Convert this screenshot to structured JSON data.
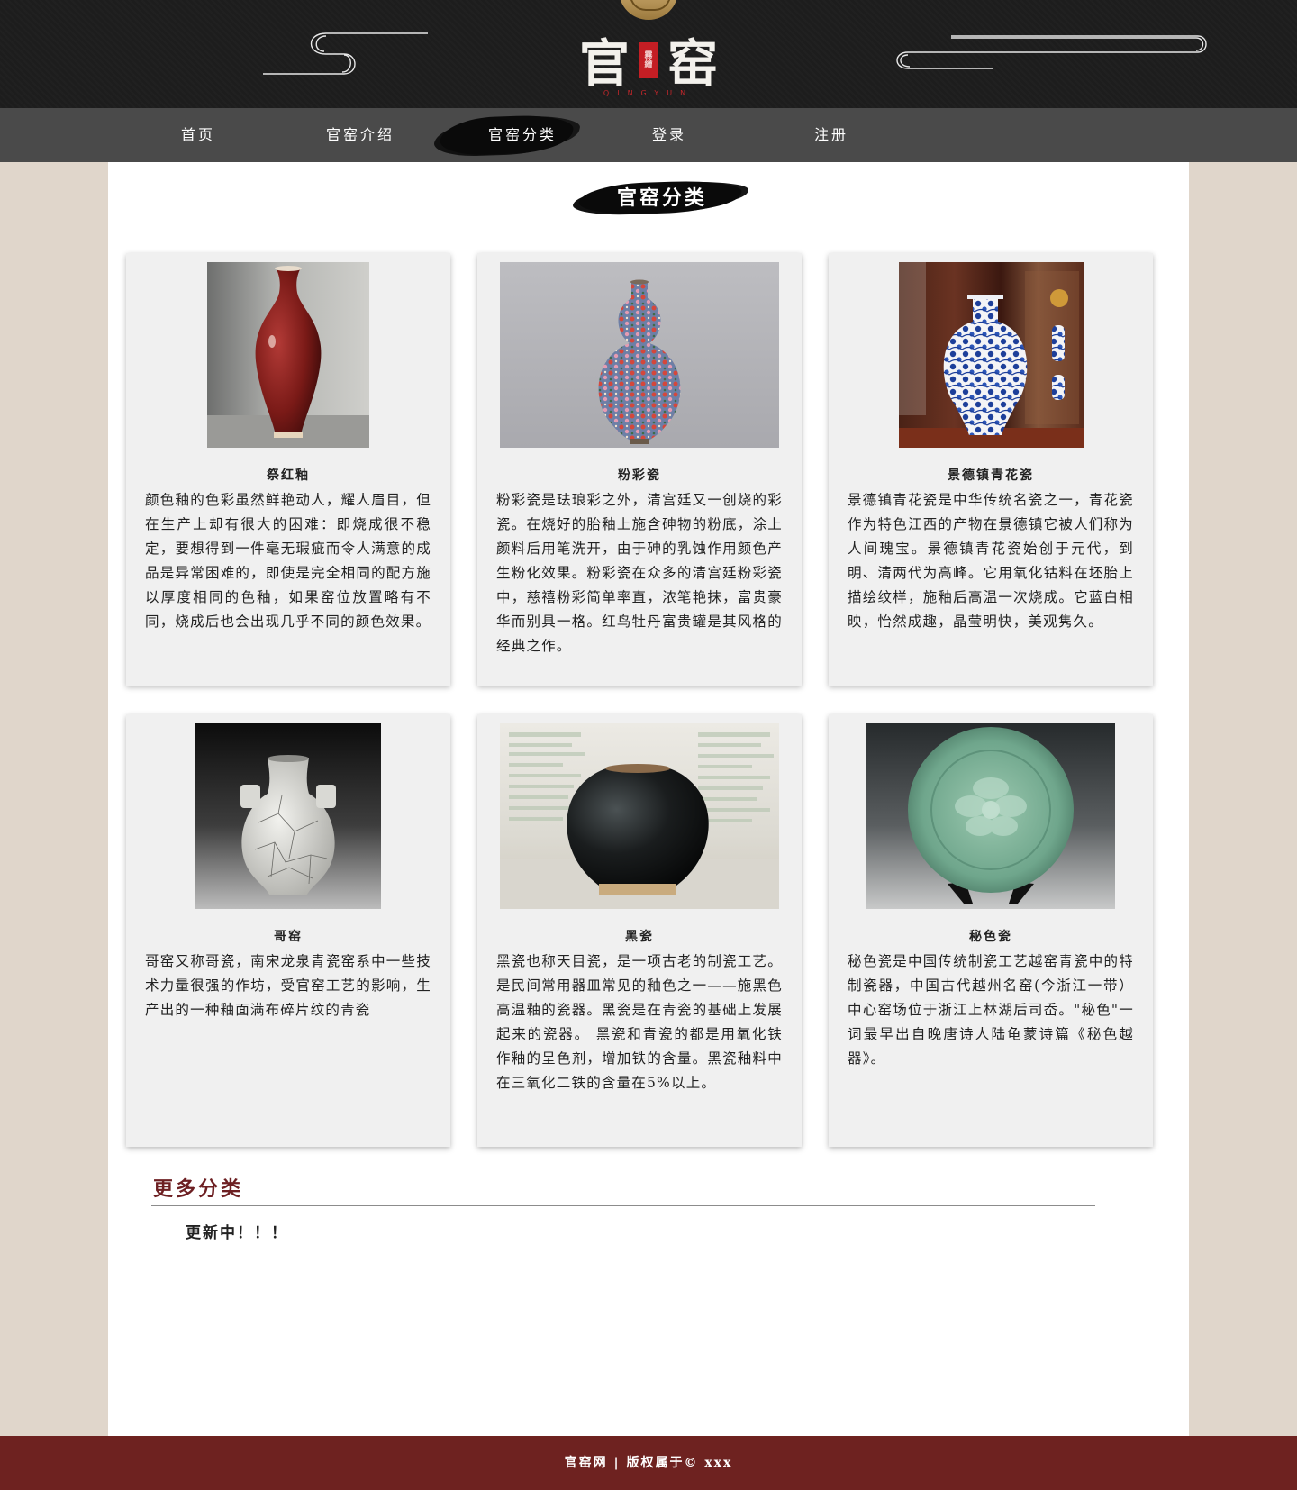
{
  "brand": {
    "char1": "官",
    "char2": "窑",
    "seal": [
      "霧",
      "繪"
    ],
    "subtitle": "QINGYUN"
  },
  "nav": {
    "items": [
      {
        "label": "首页"
      },
      {
        "label": "官窑介绍"
      },
      {
        "label": "官窑分类",
        "active": true
      },
      {
        "label": "登录"
      },
      {
        "label": "注册"
      }
    ]
  },
  "section": {
    "title": "官窑分类"
  },
  "cards": [
    {
      "name": "祭红釉",
      "image": "red-glaze-vase-photo",
      "desc": "颜色釉的色彩虽然鲜艳动人，耀人眉目，但在生产上却有很大的困难：即烧成很不稳定，要想得到一件毫无瑕疵而令人满意的成品是异常困难的，即使是完全相同的配方施以厚度相同的色釉，如果窑位放置略有不同，烧成后也会出现几乎不同的颜色效果。"
    },
    {
      "name": "粉彩瓷",
      "image": "famille-rose-gourd-vase-photo",
      "desc": "粉彩瓷是珐琅彩之外，清宫廷又一创烧的彩瓷。在烧好的胎釉上施含砷物的粉底，涂上颜料后用笔洗开，由于砷的乳蚀作用颜色产生粉化效果。粉彩瓷在众多的清宫廷粉彩瓷中，慈禧粉彩简单率直，浓笔艳抹，富贵豪华而别具一格。红鸟牡丹富贵罐是其风格的经典之作。"
    },
    {
      "name": "景德镇青花瓷",
      "image": "blue-white-vase-photo",
      "desc": "景德镇青花瓷是中华传统名瓷之一，青花瓷作为特色江西的产物在景德镇它被人们称为人间瑰宝。景德镇青花瓷始创于元代，到明、清两代为高峰。它用氧化钴料在坯胎上描绘纹样，施釉后高温一次烧成。它蓝白相映，怡然成趣，晶莹明快，美观隽久。"
    },
    {
      "name": "哥窑",
      "image": "crackle-vase-photo",
      "desc": "哥窑又称哥瓷，南宋龙泉青瓷窑系中一些技术力量很强的作坊，受官窑工艺的影响，生产出的一种釉面满布碎片纹的青瓷"
    },
    {
      "name": "黑瓷",
      "image": "black-jar-photo",
      "desc": "黑瓷也称天目瓷，是一项古老的制瓷工艺。是民间常用器皿常见的釉色之一——施黑色高温釉的瓷器。黑瓷是在青瓷的基础上发展起来的瓷器。 黑瓷和青瓷的都是用氧化铁作釉的呈色剂，增加铁的含量。黑瓷釉料中在三氧化二铁的含量在5%以上。"
    },
    {
      "name": "秘色瓷",
      "image": "celadon-plate-photo",
      "desc": "秘色瓷是中国传统制瓷工艺越窑青瓷中的特制瓷器，中国古代越州名窑(今浙江一带）中心窑场位于浙江上林湖后司岙。\"秘色\"一词最早出自晚唐诗人陆龟蒙诗篇《秘色越器》。"
    }
  ],
  "more": {
    "title": "更多分类",
    "body": "更新中！！！"
  },
  "footer": {
    "text": "官窑网 | 版权属于© xxx"
  },
  "colors": {
    "header_bg": "#1d1d1d",
    "nav_bg": "#4a4a4a",
    "page_bg": "#e0d6cb",
    "card_bg": "#f0f0f0",
    "accent_red": "#6e2220",
    "more_title": "#6d1f22"
  }
}
